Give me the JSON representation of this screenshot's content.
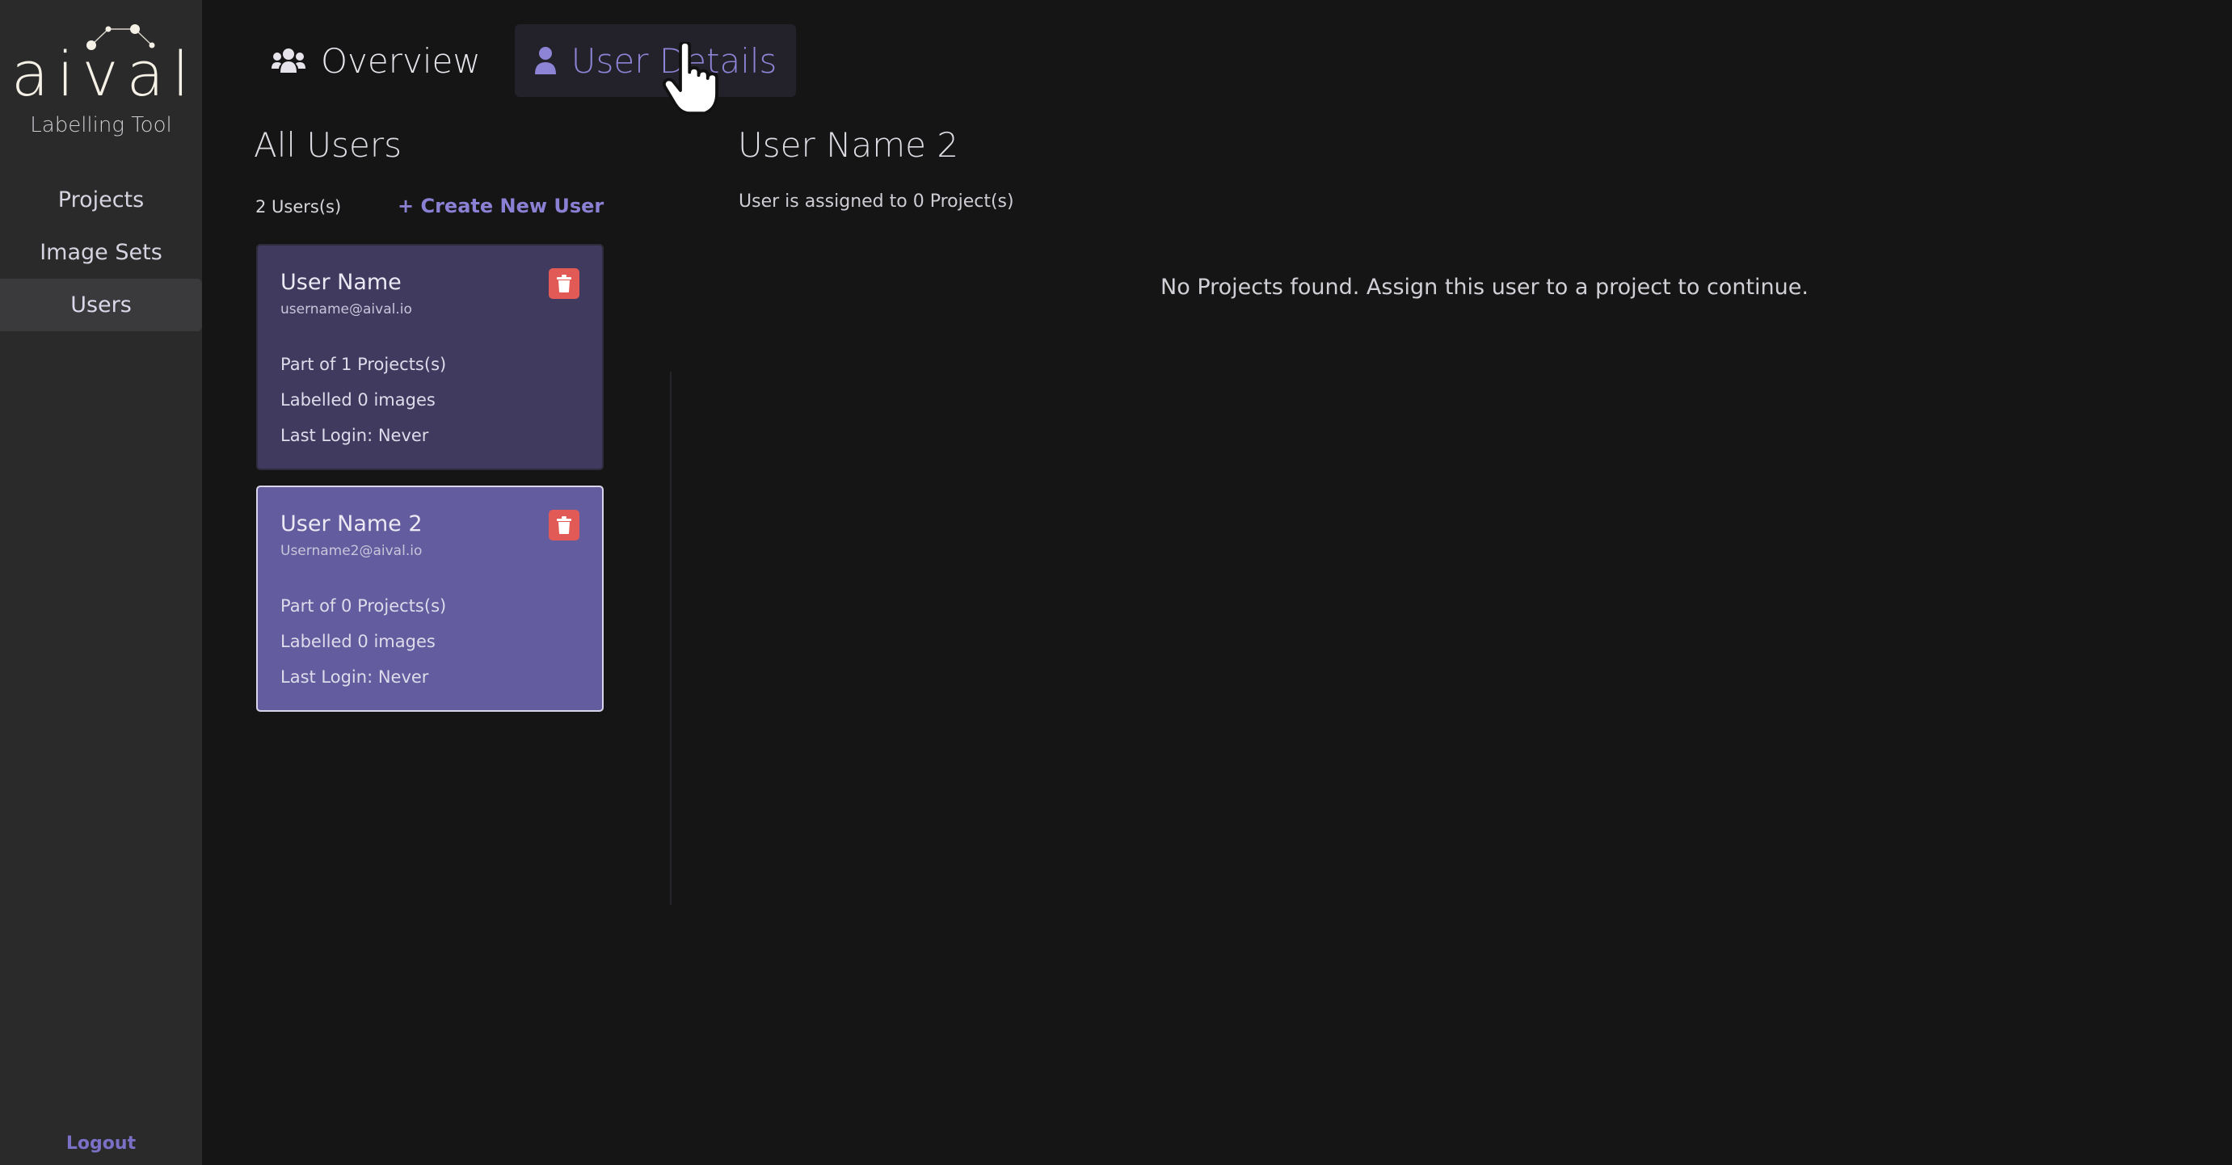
{
  "sidebar": {
    "logo_word": "aival",
    "logo_subtitle": "Labelling Tool",
    "items": [
      {
        "label": "Projects",
        "active": false
      },
      {
        "label": "Image Sets",
        "active": false
      },
      {
        "label": "Users",
        "active": true
      }
    ],
    "logout_label": "Logout"
  },
  "tabs": [
    {
      "label": "Overview",
      "icon": "users-icon",
      "active": false
    },
    {
      "label": "User Details",
      "icon": "user-icon",
      "active": true
    }
  ],
  "users_list": {
    "title": "All Users",
    "count_label": "2 Users(s)",
    "create_label": "+ Create New User",
    "users": [
      {
        "name": "User Name",
        "email": "username@aival.io",
        "projects": "Part of 1 Projects(s)",
        "labelled": "Labelled 0 images",
        "last_login": "Last Login: Never",
        "selected": false
      },
      {
        "name": "User Name 2",
        "email": "Username2@aival.io",
        "projects": "Part of 0 Projects(s)",
        "labelled": "Labelled 0 images",
        "last_login": "Last Login: Never",
        "selected": true
      }
    ]
  },
  "detail": {
    "title": "User Name 2",
    "assigned_label": "User is assigned to 0 Project(s)",
    "empty_message": "No Projects found. Assign this user to a project to continue."
  },
  "colors": {
    "accent": "#8a80d4",
    "sidebar_bg": "#2a2a2a",
    "main_bg": "#151515",
    "card_bg": "#3f3a5e",
    "card_selected_bg": "#635c9e",
    "delete_red": "#e25a55"
  }
}
